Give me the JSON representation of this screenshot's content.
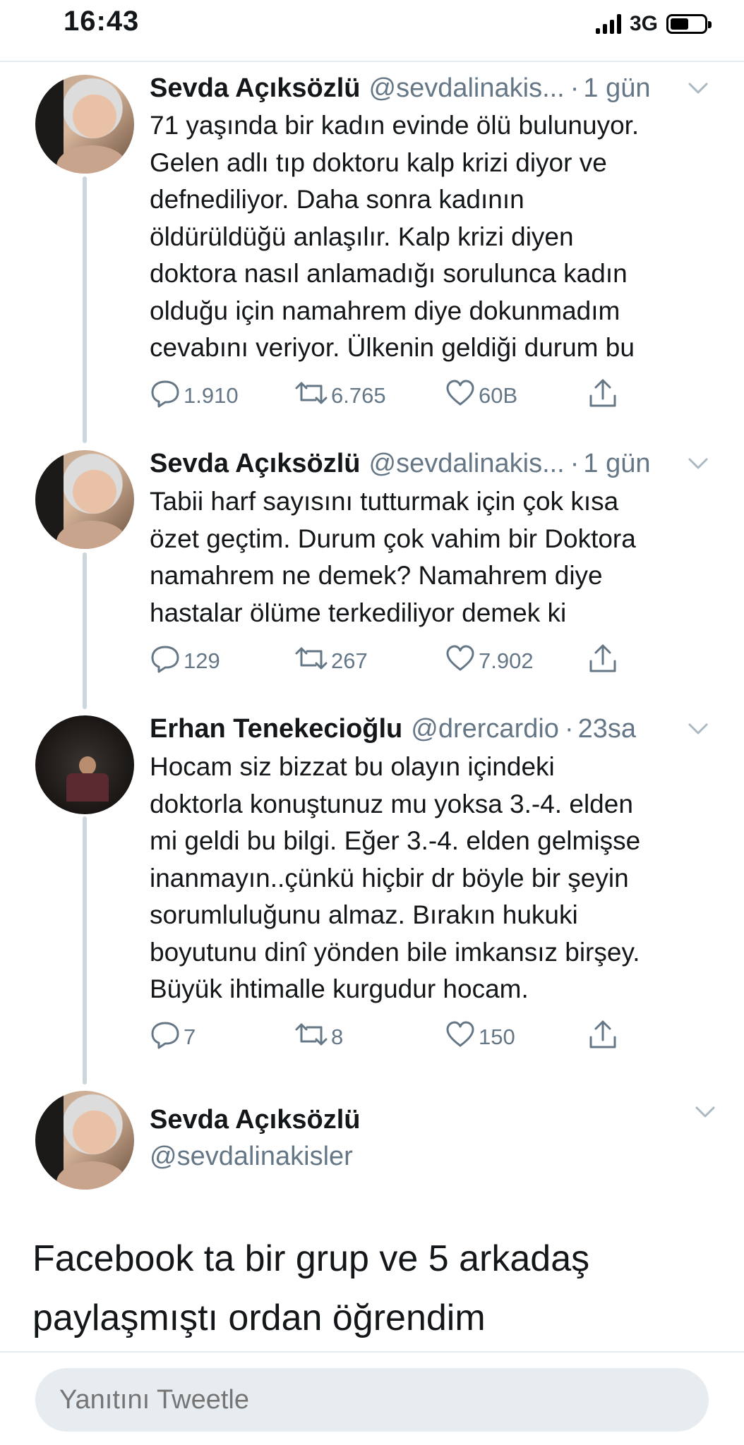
{
  "status_bar": {
    "time": "16:43",
    "network": "3G"
  },
  "colors": {
    "text_primary": "#14171a",
    "text_secondary": "#657786",
    "thread_line": "#ccd6dd",
    "divider": "#e6ecf0"
  },
  "tweets": [
    {
      "name": "Sevda Açıksözlü",
      "handle": "@sevdalinakis...",
      "dot": "·",
      "time": "1 gün",
      "text_lines": [
        "71 yaşında bir kadın evinde ölü bulunuyor.",
        "Gelen adlı tıp  doktoru kalp krizi diyor ve",
        "defnediliyor. Daha sonra kadının",
        "öldürüldüğü anlaşılır. Kalp krizi diyen",
        "doktora nasıl anlamadığı sorulunca kadın",
        "olduğu için namahrem diye dokunmadım",
        "cevabını veriyor. Ülkenin geldiği durum bu"
      ],
      "replies": "1.910",
      "retweets": "6.765",
      "likes": "60B"
    },
    {
      "name": "Sevda Açıksözlü",
      "handle": "@sevdalinakis...",
      "dot": "·",
      "time": "1 gün",
      "text_lines": [
        "Tabii harf sayısını tutturmak için çok kısa",
        "özet geçtim. Durum çok vahim bir Doktora",
        "namahrem ne demek? Namahrem diye",
        "hastalar ölüme terkediliyor demek ki"
      ],
      "replies": "129",
      "retweets": "267",
      "likes": "7.902"
    },
    {
      "name": "Erhan Tenekecioğlu",
      "handle": "@drercardio",
      "dot": "·",
      "time": "23sa",
      "text_lines": [
        "Hocam siz bizzat bu olayın içindeki",
        "doktorla konuştunuz mu yoksa 3.-4.  elden",
        "mi geldi bu bilgi. Eğer 3.-4. elden gelmişse",
        "inanmayın..çünkü hiçbir dr böyle bir şeyin",
        "sorumluluğunu almaz. Bırakın hukuki",
        "boyutunu dinî yönden bile imkansız birşey.",
        "Büyük ihtimalle kurgudur hocam."
      ],
      "replies": "7",
      "retweets": "8",
      "likes": "150"
    }
  ],
  "main_tweet": {
    "name": "Sevda Açıksözlü",
    "handle": "@sevdalinakisler",
    "text_lines": [
      "Facebook ta bir grup ve 5 arkadaş",
      "paylaşmıştı ordan öğrendim"
    ]
  },
  "reply_bar": {
    "placeholder": "Yanıtını Tweetle"
  }
}
